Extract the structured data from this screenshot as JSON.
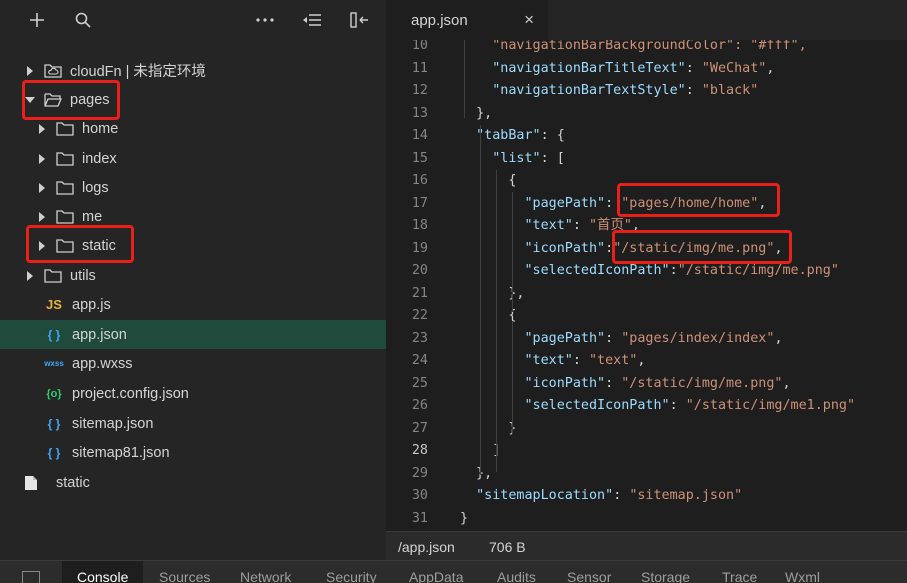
{
  "sidebar": {
    "toolbar": {
      "add": "+",
      "more": "···"
    },
    "tree": [
      {
        "label": "cloudFn | 未指定环境",
        "kind": "folder-cloud",
        "indent": 0,
        "expanded": false
      },
      {
        "label": "pages",
        "kind": "folder-open",
        "indent": 0,
        "expanded": true
      },
      {
        "label": "home",
        "kind": "folder",
        "indent": 1,
        "expanded": false
      },
      {
        "label": "index",
        "kind": "folder",
        "indent": 1,
        "expanded": false
      },
      {
        "label": "logs",
        "kind": "folder",
        "indent": 1,
        "expanded": false
      },
      {
        "label": "me",
        "kind": "folder",
        "indent": 1,
        "expanded": false
      },
      {
        "label": "static",
        "kind": "folder",
        "indent": 1,
        "expanded": false
      },
      {
        "label": "utils",
        "kind": "folder",
        "indent": 0,
        "expanded": false
      },
      {
        "label": "app.js",
        "kind": "js",
        "icon_text": "JS",
        "indent": 0
      },
      {
        "label": "app.json",
        "kind": "json",
        "icon_text": "{ }",
        "indent": 0,
        "selected": true
      },
      {
        "label": "app.wxss",
        "kind": "wxss",
        "icon_text": "wxss",
        "indent": 0
      },
      {
        "label": "project.config.json",
        "kind": "config",
        "icon_text": "{o}",
        "indent": 0
      },
      {
        "label": "sitemap.json",
        "kind": "json",
        "icon_text": "{ }",
        "indent": 0
      },
      {
        "label": "sitemap81.json",
        "kind": "json",
        "icon_text": "{ }",
        "indent": 0
      },
      {
        "label": "static",
        "kind": "file",
        "indent": -1
      }
    ]
  },
  "editor": {
    "tab": {
      "label": "app.json",
      "close": "×"
    },
    "lines": [
      {
        "n": "10",
        "t": [
          [
            "s",
            "    \"navigationBarBackgroundColor\": \"#fff\","
          ]
        ]
      },
      {
        "n": "11",
        "t": [
          [
            "p",
            "    "
          ],
          [
            "k",
            "\"navigationBarTitleText\""
          ],
          [
            "p",
            ": "
          ],
          [
            "s",
            "\"WeChat\""
          ],
          [
            "p",
            ","
          ]
        ]
      },
      {
        "n": "12",
        "t": [
          [
            "p",
            "    "
          ],
          [
            "k",
            "\"navigationBarTextStyle\""
          ],
          [
            "p",
            ": "
          ],
          [
            "s",
            "\"black\""
          ]
        ]
      },
      {
        "n": "13",
        "t": [
          [
            "p",
            "  },"
          ]
        ]
      },
      {
        "n": "14",
        "t": [
          [
            "p",
            "  "
          ],
          [
            "k",
            "\"tabBar\""
          ],
          [
            "p",
            ": {"
          ]
        ]
      },
      {
        "n": "15",
        "t": [
          [
            "p",
            "    "
          ],
          [
            "k",
            "\"list\""
          ],
          [
            "p",
            ": ["
          ]
        ]
      },
      {
        "n": "16",
        "t": [
          [
            "p",
            "      {"
          ]
        ]
      },
      {
        "n": "17",
        "t": [
          [
            "p",
            "        "
          ],
          [
            "k",
            "\"pagePath\""
          ],
          [
            "p",
            ": "
          ],
          [
            "s",
            "\"pages/home/home\""
          ],
          [
            "p",
            ","
          ]
        ]
      },
      {
        "n": "18",
        "t": [
          [
            "p",
            "        "
          ],
          [
            "k",
            "\"text\""
          ],
          [
            "p",
            ": "
          ],
          [
            "s",
            "\"首页\""
          ],
          [
            "p",
            ","
          ]
        ]
      },
      {
        "n": "19",
        "t": [
          [
            "p",
            "        "
          ],
          [
            "k",
            "\"iconPath\""
          ],
          [
            "p",
            ":"
          ],
          [
            "s",
            "\"/static/img/me.png\""
          ],
          [
            "p",
            ","
          ]
        ]
      },
      {
        "n": "20",
        "t": [
          [
            "p",
            "        "
          ],
          [
            "k",
            "\"selectedIconPath\""
          ],
          [
            "p",
            ":"
          ],
          [
            "s",
            "\"/static/img/me.png\""
          ]
        ]
      },
      {
        "n": "21",
        "t": [
          [
            "p",
            "      },"
          ]
        ]
      },
      {
        "n": "22",
        "t": [
          [
            "p",
            "      {"
          ]
        ]
      },
      {
        "n": "23",
        "t": [
          [
            "p",
            "        "
          ],
          [
            "k",
            "\"pagePath\""
          ],
          [
            "p",
            ": "
          ],
          [
            "s",
            "\"pages/index/index\""
          ],
          [
            "p",
            ","
          ]
        ]
      },
      {
        "n": "24",
        "t": [
          [
            "p",
            "        "
          ],
          [
            "k",
            "\"text\""
          ],
          [
            "p",
            ": "
          ],
          [
            "s",
            "\"text\""
          ],
          [
            "p",
            ","
          ]
        ]
      },
      {
        "n": "25",
        "t": [
          [
            "p",
            "        "
          ],
          [
            "k",
            "\"iconPath\""
          ],
          [
            "p",
            ": "
          ],
          [
            "s",
            "\"/static/img/me.png\""
          ],
          [
            "p",
            ","
          ]
        ]
      },
      {
        "n": "26",
        "t": [
          [
            "p",
            "        "
          ],
          [
            "k",
            "\"selectedIconPath\""
          ],
          [
            "p",
            ": "
          ],
          [
            "s",
            "\"/static/img/me1.png\""
          ]
        ]
      },
      {
        "n": "27",
        "t": [
          [
            "p",
            "      }"
          ]
        ]
      },
      {
        "n": "28",
        "t": [
          [
            "p",
            "    ]"
          ]
        ],
        "current": true
      },
      {
        "n": "29",
        "t": [
          [
            "p",
            "  },"
          ]
        ]
      },
      {
        "n": "30",
        "t": [
          [
            "p",
            "  "
          ],
          [
            "k",
            "\"sitemapLocation\""
          ],
          [
            "p",
            ": "
          ],
          [
            "s",
            "\"sitemap.json\""
          ]
        ]
      },
      {
        "n": "31",
        "t": [
          [
            "p",
            "}"
          ]
        ]
      }
    ]
  },
  "status": {
    "path": "/app.json",
    "size": "706 B"
  },
  "bottom_tabs": [
    "Console",
    "Sources",
    "Network",
    "Security",
    "AppData",
    "Audits",
    "Sensor",
    "Storage",
    "Trace",
    "Wxml"
  ],
  "colors": {
    "highlight_box": "#e8201a",
    "selected_row": "#1f4a3c",
    "js_icon": "#e3b341",
    "json_icon": "#3fa7f5",
    "config_icon": "#2ecc71"
  }
}
